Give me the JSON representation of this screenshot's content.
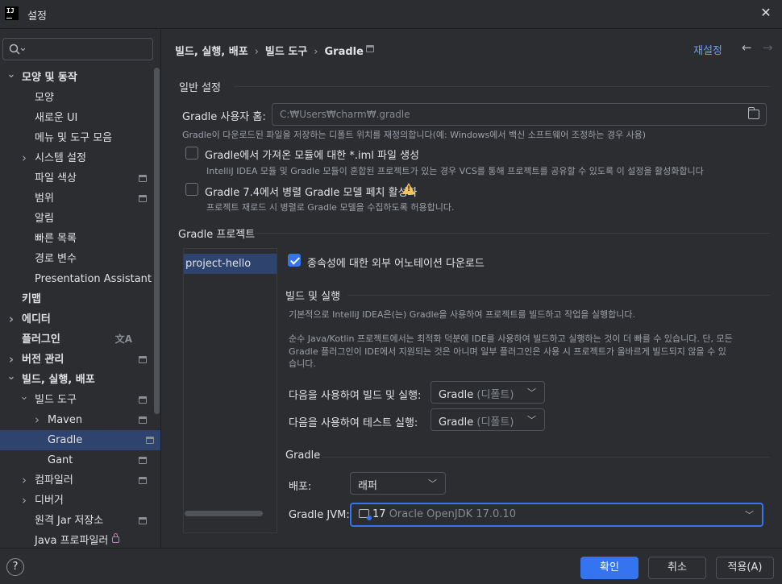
{
  "window": {
    "title": "설정",
    "logo": "IJ"
  },
  "sidebar": {
    "search_placeholder": "",
    "items": [
      {
        "label": "모양 및 동작",
        "bold": true,
        "level": 0,
        "chevron": "down"
      },
      {
        "label": "모양",
        "level": 1
      },
      {
        "label": "새로운 UI",
        "level": 1
      },
      {
        "label": "메뉴 및 도구 모음",
        "level": 1
      },
      {
        "label": "시스템 설정",
        "level": 1,
        "chevron": "right"
      },
      {
        "label": "파일 색상",
        "level": 1,
        "mark": true
      },
      {
        "label": "범위",
        "level": 1,
        "mark": true
      },
      {
        "label": "알림",
        "level": 1
      },
      {
        "label": "빠른 목록",
        "level": 1
      },
      {
        "label": "경로 변수",
        "level": 1
      },
      {
        "label": "Presentation Assistant",
        "level": 1
      },
      {
        "label": "키맵",
        "bold": true,
        "level": 0
      },
      {
        "label": "에디터",
        "bold": true,
        "level": 0,
        "chevron": "right"
      },
      {
        "label": "플러그인",
        "bold": true,
        "level": 0,
        "translate_icon": true
      },
      {
        "label": "버전 관리",
        "bold": true,
        "level": 0,
        "chevron": "right",
        "mark": true
      },
      {
        "label": "빌드, 실행, 배포",
        "bold": true,
        "level": 0,
        "chevron": "down"
      },
      {
        "label": "빌드 도구",
        "level": 1,
        "chevron": "down",
        "mark": true
      },
      {
        "label": "Maven",
        "level": 2,
        "chevron": "right",
        "mark": true
      },
      {
        "label": "Gradle",
        "level": 2,
        "mark": true,
        "selected": true
      },
      {
        "label": "Gant",
        "level": 2,
        "mark": true
      },
      {
        "label": "컴파일러",
        "level": 1,
        "chevron": "right",
        "mark": true
      },
      {
        "label": "디버거",
        "level": 1,
        "chevron": "right"
      },
      {
        "label": "원격 Jar 저장소",
        "level": 1,
        "mark": true
      },
      {
        "label": "Java 프로파일러",
        "level": 1,
        "lock": true
      }
    ]
  },
  "header": {
    "breadcrumb": [
      "빌드, 실행, 배포",
      "빌드 도구",
      "Gradle"
    ],
    "reset_label": "재설정",
    "back_icon": "arrow-left-icon",
    "forward_icon": "arrow-right-icon"
  },
  "general": {
    "title": "일반 설정",
    "user_home_label": "Gradle 사용자 홈:",
    "user_home_value": "C:₩Users₩charm₩.gradle",
    "user_home_hint": "Gradle이 다운로드된 파일을 저장하는 디폴트 위치를 재정의합니다(예: Windows에서 백신 소프트웨어 조정하는 경우 사용)",
    "iml_label": "Gradle에서 가져온 모듈에 대한 *.iml 파일 생성",
    "iml_checked": false,
    "iml_hint": "IntelliJ IDEA 모듈 및 Gradle 모듈이 혼합된 프로젝트가 있는 경우 VCS를 통해 프로젝트를 공유할 수 있도록 이 설정을 활성화합니다",
    "parallel_label": "Gradle 7.4에서 병렬 Gradle 모델 페치 활성화",
    "parallel_checked": false,
    "parallel_hint": "프로젝트 재로드 시 병렬로 Gradle 모델을 수집하도록 허용합니다."
  },
  "projects": {
    "title": "Gradle 프로젝트",
    "list": [
      "project-hello"
    ],
    "download_annotations_label": "종속성에 대한 외부 어노테이션 다운로드",
    "download_annotations_checked": true,
    "build_run": {
      "title": "빌드 및 실행",
      "desc1": "기본적으로 IntelliJ IDEA은(는) Gradle을 사용하여 프로젝트를 빌드하고 작업을 실행합니다.",
      "desc2_line1": "순수 Java/Kotlin 프로젝트에서는 최적화 덕분에 IDE를 사용하여 빌드하고 실행하는 것이 더 빠를 수 있습니다. 단, 모든",
      "desc2_line2": "Gradle 플러그인이 IDE에서 지원되는 것은 아니며 일부 플러그인은 사용 시 프로젝트가 올바르게 빌드되지 않을 수 있",
      "desc2_line3": "습니다.",
      "build_run_using_label": "다음을 사용하여 빌드 및 실행:",
      "build_run_using_value": "Gradle",
      "build_run_using_suffix": "(디폴트)",
      "test_using_label": "다음을 사용하여 테스트 실행:",
      "test_using_value": "Gradle",
      "test_using_suffix": "(디폴트)"
    },
    "gradle": {
      "title": "Gradle",
      "distribution_label": "배포:",
      "distribution_value": "래퍼",
      "jvm_label": "Gradle JVM:",
      "jvm_version": "17",
      "jvm_name": "Oracle OpenJDK 17.0.10"
    }
  },
  "footer": {
    "help_label": "?",
    "ok_label": "확인",
    "cancel_label": "취소",
    "apply_label": "적용(A)"
  },
  "colors": {
    "accent": "#3574f0",
    "link": "#6aa1f9",
    "selection": "#2e436e",
    "background": "#2b2d30"
  }
}
